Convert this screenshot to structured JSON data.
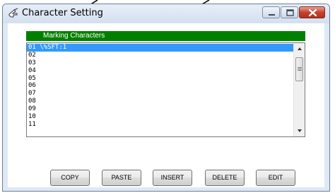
{
  "window": {
    "title": "Character Setting"
  },
  "list": {
    "header": "Marking Characters",
    "items": [
      "01 \\%SFT:1",
      "02",
      "03",
      "04",
      "05",
      "06",
      "07",
      "08",
      "09",
      "10",
      "11"
    ],
    "selected_index": 0
  },
  "buttons": {
    "copy": "COPY",
    "paste": "PASTE",
    "insert": "INSERT",
    "delete": "DELETE",
    "edit": "EDIT"
  },
  "colors": {
    "header_bg": "#008000",
    "selection_bg": "#3399ff",
    "close_button": "#c8412d"
  },
  "icons": {
    "app": "pointer-hand-icon",
    "minimize": "minimize-icon",
    "maximize": "maximize-icon",
    "close": "close-icon"
  }
}
